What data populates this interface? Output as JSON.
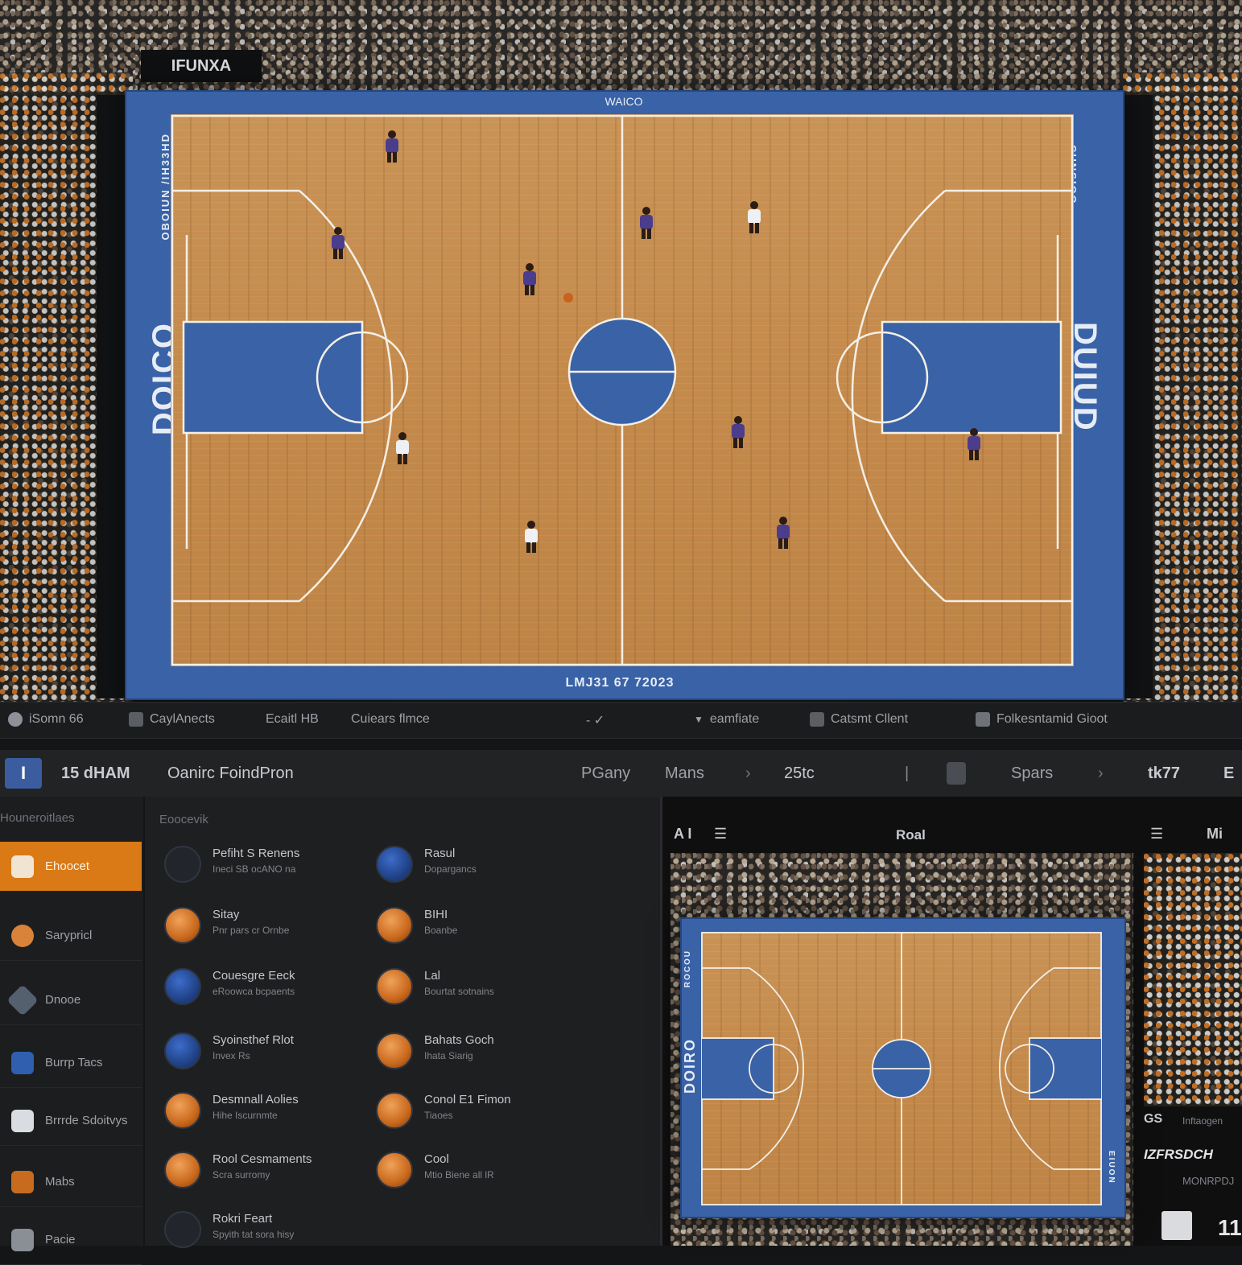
{
  "broadcast": {
    "top_board": "WAICO",
    "top_left_board": "IFUNXA",
    "bottom_board": "LMJ31 67 72023",
    "left_court_text": "DOICO",
    "right_court_text": "DUIUD",
    "left_side_text": "OBOIUN /IH33HD",
    "right_side_text": "CUNSIOO"
  },
  "toolbar": {
    "items": [
      {
        "label": "iSomn 66",
        "icon": "status-icon"
      },
      {
        "label": "CaylAnects",
        "icon": "player-icon"
      },
      {
        "label": "Ecaitl HB",
        "icon": ""
      },
      {
        "label": "Cuiears flmce",
        "icon": ""
      },
      {
        "label": "- ✓",
        "icon": ""
      },
      {
        "label": "eamfiate",
        "icon": "filter-icon"
      },
      {
        "label": "Catsmt Cllent",
        "icon": "camera-icon"
      },
      {
        "label": "Folkesntamid Gioot",
        "icon": "folder-icon"
      }
    ]
  },
  "header": {
    "logo_text": "I",
    "time": "15 dHAM",
    "title": "Oanirc FoindPron",
    "nav1": "PGany",
    "nav2": "Mans",
    "score": "25tc",
    "divider": "|",
    "team": "Spars",
    "right_val": "tk77",
    "right_end": "E"
  },
  "sidebar": {
    "heading": "Houneroitlaes",
    "items": [
      {
        "label": "Ehoocet",
        "icon": "home-icon",
        "active": true
      },
      {
        "label": "Sarypricl",
        "icon": "globe-icon"
      },
      {
        "label": "Dnooe",
        "icon": "tag-icon"
      },
      {
        "label": "Burrp Tacs",
        "icon": "player-icon"
      },
      {
        "label": "Brrrde Sdoitvys",
        "icon": "dribble-icon"
      },
      {
        "label": "Mabs",
        "icon": "trophy-icon"
      },
      {
        "label": "Pacie",
        "icon": "court-icon"
      }
    ]
  },
  "list": {
    "heading": "Eoocevik",
    "items": [
      {
        "title": "Pefiht S Renens",
        "sub": "Ineci SB ocANO na",
        "icon": "target-icon",
        "style": "dark"
      },
      {
        "title": "Rasul",
        "sub": "Dopargancs",
        "icon": "jersey-9-icon",
        "style": "blue"
      },
      {
        "title": "Sitay",
        "sub": "Pnr pars cr Ornbe",
        "icon": "basketball-icon",
        "style": "ball"
      },
      {
        "title": "BIHI",
        "sub": "Boanbe",
        "icon": "basketball-icon",
        "style": "ball"
      },
      {
        "title": "Couesgre Eeck",
        "sub": "eRoowca bcpaents",
        "icon": "shoe-icon",
        "style": "blue"
      },
      {
        "title": "Lal",
        "sub": "Bourtat sotnains",
        "icon": "ball-icon",
        "style": "ball"
      },
      {
        "title": "Syoinsthef Rlot",
        "sub": "Invex Rs",
        "icon": "player-icon",
        "style": "blue"
      },
      {
        "title": "Bahats Goch",
        "sub": "Ihata Siarig",
        "icon": "eye-icon",
        "style": "ball"
      },
      {
        "title": "Desmnall Aolies",
        "sub": "Hihe Iscurnmte",
        "icon": "basketball-icon",
        "style": "ball"
      },
      {
        "title": "Conol E1 Fimon",
        "sub": "Tiaoes",
        "icon": "basketball-icon",
        "style": "ball"
      },
      {
        "title": "Rool Cesmaments",
        "sub": "Scra surromy",
        "icon": "ball-icon",
        "style": "ball"
      },
      {
        "title": "Cool",
        "sub": "Mtio Biene all lR",
        "icon": "basketball-icon",
        "style": "ball"
      },
      {
        "title": "Rokri Feart",
        "sub": "Spyith tat sora hisy",
        "icon": "pin-icon",
        "style": "dark"
      }
    ]
  },
  "preview": {
    "left_label": "A I",
    "title": "Roal",
    "right_label": "Mi",
    "court_text": "DOIRO",
    "side_text1": "ROCOU",
    "side_text2": "EIUON",
    "right_panel_label": "GS",
    "right_panel_label2": "Inftaogen",
    "right_panel_title": "IZFRSDCH",
    "right_panel_sub": "MONRPDJ",
    "right_panel_num": "11"
  }
}
